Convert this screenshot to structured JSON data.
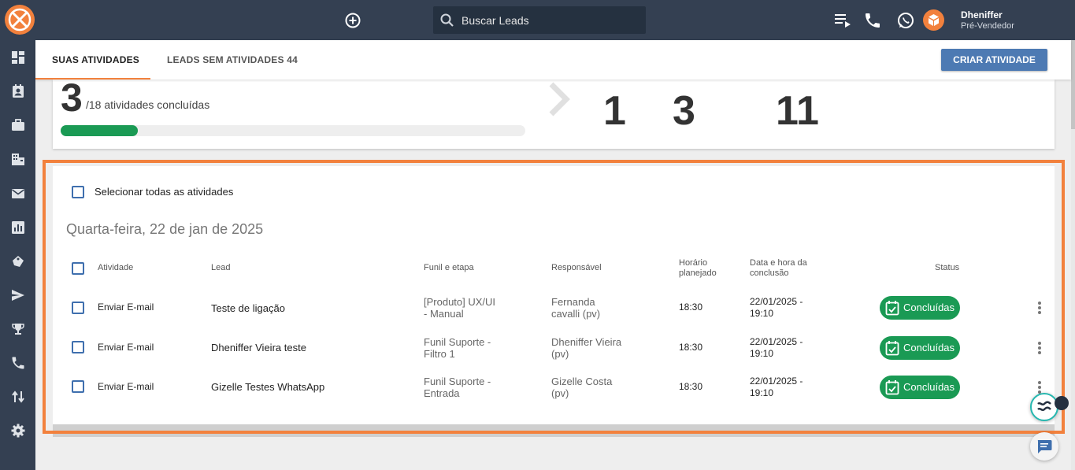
{
  "topbar": {
    "search_placeholder": "Buscar Leads",
    "user_name": "Dheniffer",
    "user_role": "Pré-Vendedor"
  },
  "tabs": [
    {
      "label": "SUAS ATIVIDADES",
      "active": true
    },
    {
      "label": "LEADS SEM ATIVIDADES 44",
      "active": false
    }
  ],
  "create_button": "CRIAR ATIVIDADE",
  "summary": {
    "completed": "3",
    "total_label": "/18 atividades concluídas",
    "progress_fraction": 0.1667,
    "stats": [
      "1",
      "3",
      "11"
    ]
  },
  "activities": {
    "select_all_label": "Selecionar todas as atividades",
    "date_heading": "Quarta-feira, 22 de jan de 2025",
    "columns": {
      "atividade": "Atividade",
      "lead": "Lead",
      "funil": "Funil e etapa",
      "responsavel": "Responsável",
      "horario_l1": "Horário",
      "horario_l2": "planejado",
      "conclusao_l1": "Data e hora da",
      "conclusao_l2": "conclusão",
      "status": "Status"
    },
    "rows": [
      {
        "atividade": "Enviar E-mail",
        "lead": "Teste de ligação",
        "funil_l1": "[Produto] UX/UI",
        "funil_l2": "- Manual",
        "resp_l1": "Fernanda",
        "resp_l2": "cavalli (pv)",
        "horario": "18:30",
        "conclusao_l1": "22/01/2025 -",
        "conclusao_l2": "19:10",
        "status": "Concluídas"
      },
      {
        "atividade": "Enviar E-mail",
        "lead": "Dheniffer Vieira teste",
        "funil_l1": "Funil Suporte -",
        "funil_l2": "Filtro 1",
        "resp_l1": "Dheniffer Vieira",
        "resp_l2": "(pv)",
        "horario": "18:30",
        "conclusao_l1": "22/01/2025 -",
        "conclusao_l2": "19:10",
        "status": "Concluídas"
      },
      {
        "atividade": "Enviar E-mail",
        "lead": "Gizelle Testes WhatsApp",
        "funil_l1": "Funil Suporte -",
        "funil_l2": "Entrada",
        "resp_l1": "Gizelle Costa",
        "resp_l2": "(pv)",
        "horario": "18:30",
        "conclusao_l1": "22/01/2025 -",
        "conclusao_l2": "19:10",
        "status": "Concluídas"
      }
    ]
  },
  "colors": {
    "topbar": "#344052",
    "accent": "#f2813d",
    "primary_button": "#4d7ab3",
    "success": "#1a9a54"
  },
  "icons": {
    "sidebar": [
      "dashboard-icon",
      "contacts-icon",
      "briefcase-icon",
      "building-icon",
      "mail-icon",
      "chart-icon",
      "tags-icon",
      "send-icon",
      "trophy-icon",
      "phone-icon",
      "swap-icon",
      "gear-icon"
    ]
  }
}
